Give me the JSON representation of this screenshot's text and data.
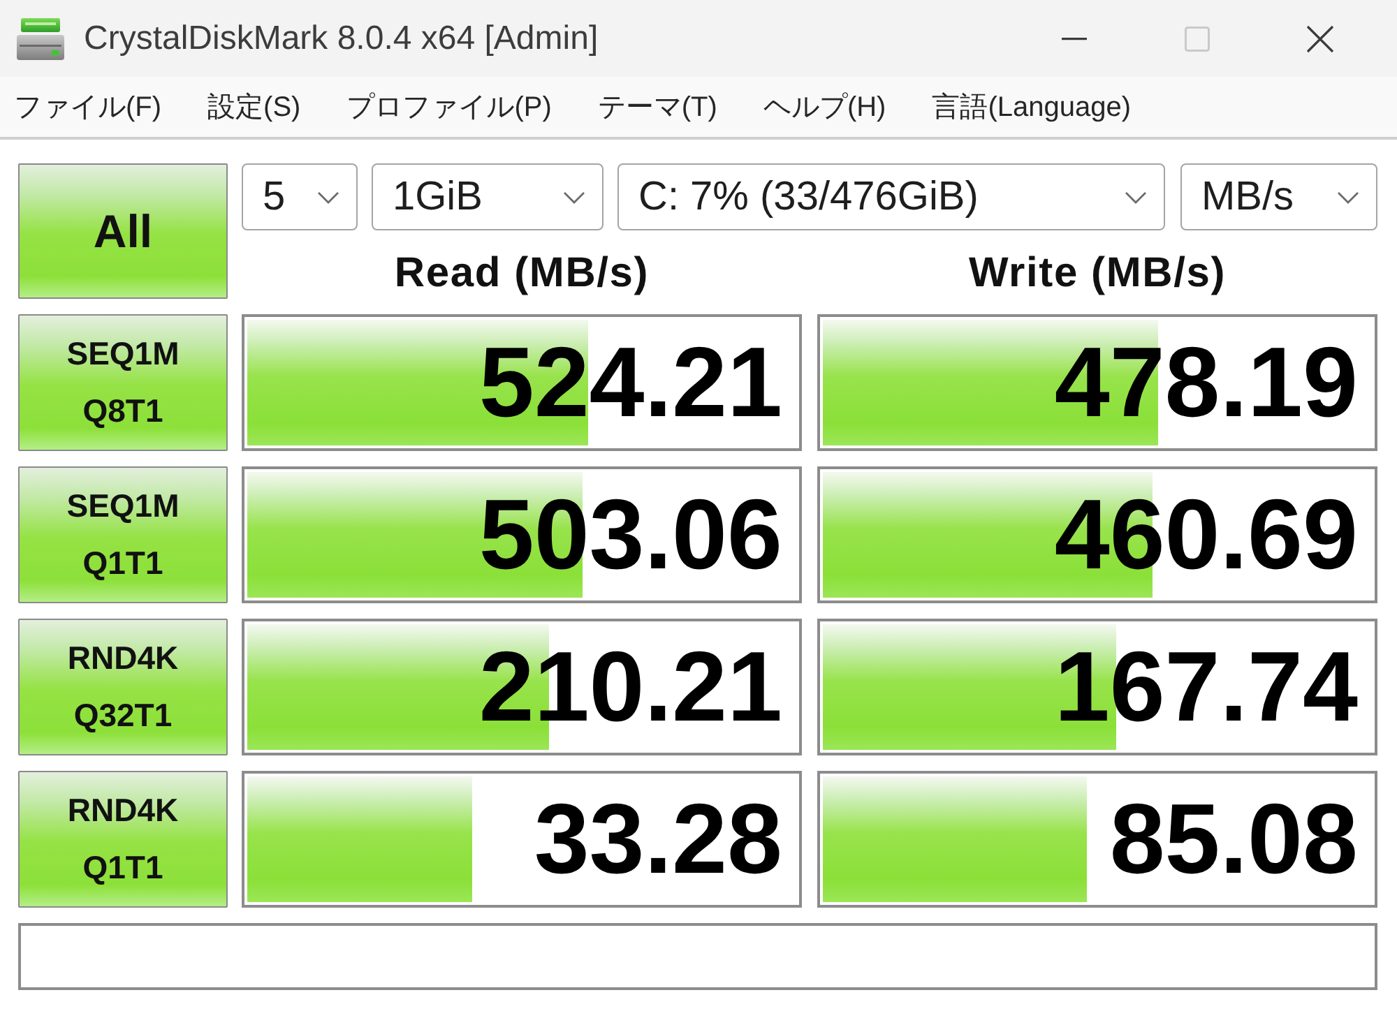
{
  "window": {
    "title": "CrystalDiskMark 8.0.4 x64 [Admin]",
    "buttons": [
      {
        "kind": "minimize",
        "disabled": false
      },
      {
        "kind": "maximize",
        "disabled": true
      },
      {
        "kind": "close",
        "disabled": false
      }
    ]
  },
  "menu": [
    "ファイル(F)",
    "設定(S)",
    "プロファイル(P)",
    "テーマ(T)",
    "ヘルプ(H)",
    "言語(Language)"
  ],
  "toolbar": {
    "all_button": "All",
    "dropdowns": [
      {
        "value": "5"
      },
      {
        "value": "1GiB"
      },
      {
        "value": "C: 7% (33/476GiB)"
      },
      {
        "value": "MB/s"
      }
    ]
  },
  "columns": [
    "Read (MB/s)",
    "Write (MB/s)"
  ],
  "tests": [
    {
      "name": "SEQ1M",
      "params": "Q8T1",
      "read": {
        "value": "524.21",
        "level": 0.62
      },
      "write": {
        "value": "478.19",
        "level": 0.61
      }
    },
    {
      "name": "SEQ1M",
      "params": "Q1T1",
      "read": {
        "value": "503.06",
        "level": 0.61
      },
      "write": {
        "value": "460.69",
        "level": 0.6
      }
    },
    {
      "name": "RND4K",
      "params": "Q32T1",
      "read": {
        "value": "210.21",
        "level": 0.55
      },
      "write": {
        "value": "167.74",
        "level": 0.535
      }
    },
    {
      "name": "RND4K",
      "params": "Q1T1",
      "read": {
        "value": "33.28",
        "level": 0.41
      },
      "write": {
        "value": "85.08",
        "level": 0.48
      }
    }
  ]
}
